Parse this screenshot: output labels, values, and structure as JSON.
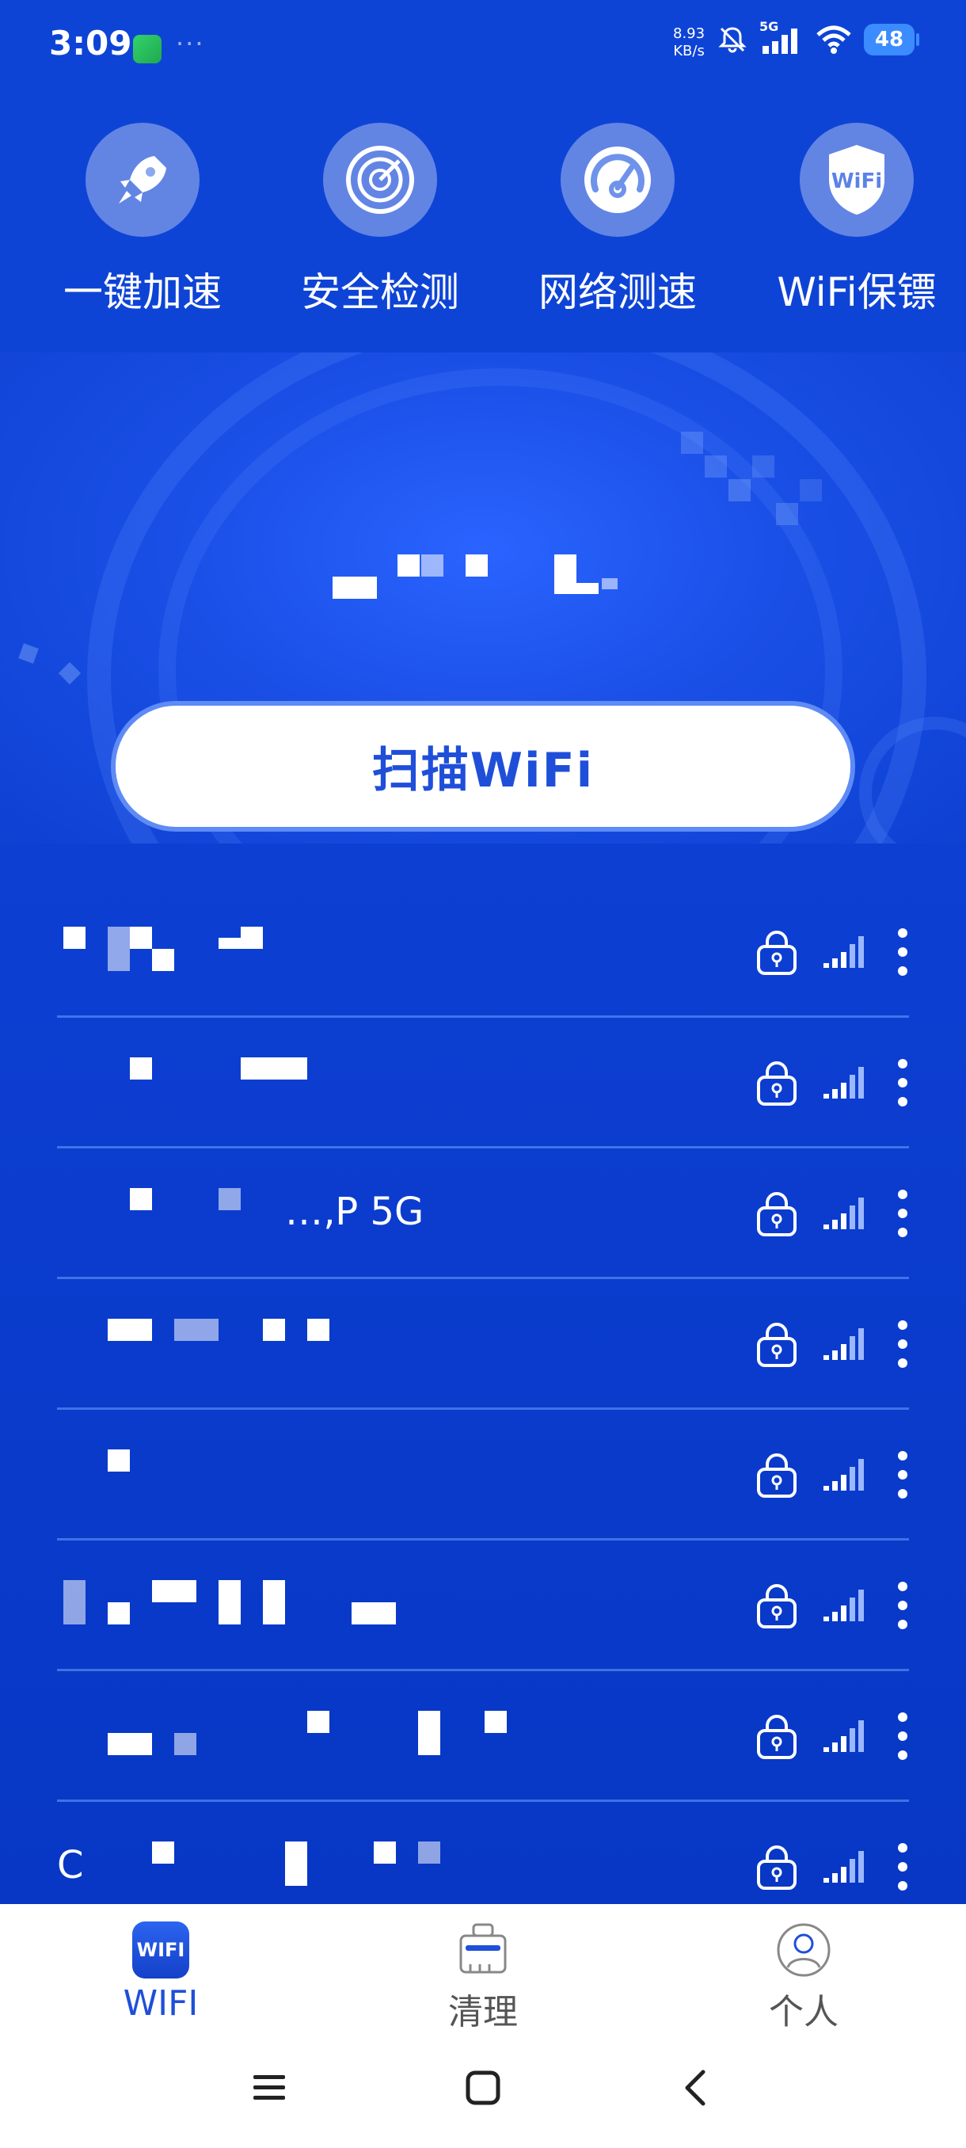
{
  "status_bar": {
    "time": "3:09",
    "net_speed_value": "8.93",
    "net_speed_unit": "KB/s",
    "network_type": "5G",
    "battery": "48"
  },
  "quick_actions": [
    {
      "label": "一键加速",
      "icon": "rocket-icon"
    },
    {
      "label": "安全检测",
      "icon": "radar-icon"
    },
    {
      "label": "网络测速",
      "icon": "speedometer-icon"
    },
    {
      "label": "WiFi保镖",
      "icon": "wifi-shield-icon"
    }
  ],
  "current_network": {
    "ssid": ""
  },
  "scan_button_label": "扫描WiFi",
  "wifi_list": [
    {
      "ssid": "",
      "locked": true
    },
    {
      "ssid": "",
      "locked": true
    },
    {
      "ssid": "…‚P 5G",
      "locked": true
    },
    {
      "ssid": "",
      "locked": true
    },
    {
      "ssid": "",
      "locked": true
    },
    {
      "ssid": "",
      "locked": true
    },
    {
      "ssid": "",
      "locked": true
    },
    {
      "ssid": "C",
      "locked": true
    }
  ],
  "bottom_nav": [
    {
      "label": "WIFI",
      "icon": "wifi-app-icon",
      "active": true,
      "badge": "WIFI"
    },
    {
      "label": "清理",
      "icon": "broom-icon",
      "active": false
    },
    {
      "label": "个人",
      "icon": "person-icon",
      "active": false
    }
  ],
  "colors": {
    "primary_blue": "#0e44d6",
    "accent_blue": "#1f4fd9",
    "battery_blue": "#3b8cff"
  }
}
